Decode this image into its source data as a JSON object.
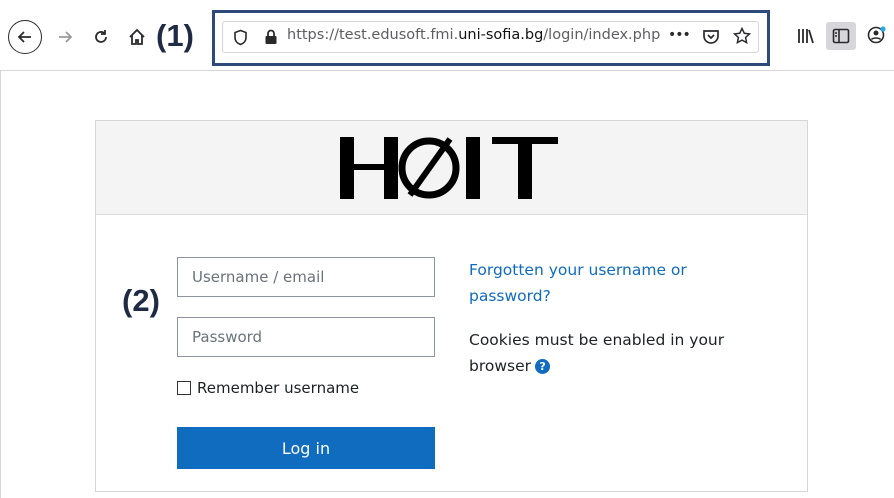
{
  "browser": {
    "url_prefix": "https://test.edusoft.fmi.",
    "url_domain": "uni-sofia.bg",
    "url_suffix": "/login/index.php",
    "more_label": "•••"
  },
  "annotations": {
    "label_1": "(1)",
    "label_2": "(2)"
  },
  "login": {
    "logo_text": "HOIT",
    "username_placeholder": "Username / email",
    "password_placeholder": "Password",
    "remember_label": "Remember username",
    "login_button": "Log in",
    "forgot_link": "Forgotten your username or password?",
    "cookies_text": "Cookies must be enabled in your browser",
    "help_glyph": "?"
  },
  "colors": {
    "accent": "#0f6cbf",
    "annotation_border": "#2e4a7a"
  }
}
